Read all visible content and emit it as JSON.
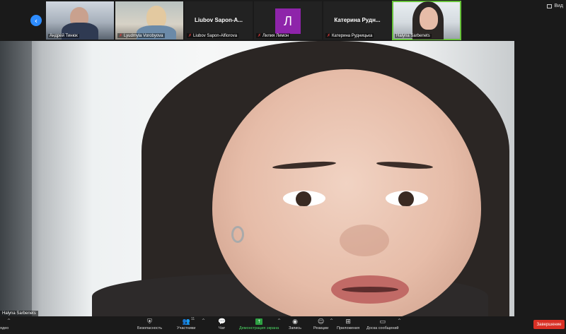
{
  "strip": {
    "view_label": "Вид",
    "tiles": [
      {
        "name": "Андрей Тинюк",
        "muted": false
      },
      {
        "name": "Lyudmyla Vorobyova",
        "muted": true
      },
      {
        "name": "Liubov Sapon-Alfiorova",
        "display_name": "Liubov  Sapon-A...",
        "muted": true
      },
      {
        "name": "Лилия Лимон",
        "avatar_letter": "Л",
        "avatar_color": "#8e24aa",
        "muted": true
      },
      {
        "name": "Катерина Рудницька",
        "display_name": "Катерина  Рудн...",
        "muted": true
      },
      {
        "name": "Halyna Sarbenets",
        "muted": false,
        "active": true
      }
    ]
  },
  "main": {
    "speaker_label": "Halyna Sarbenets"
  },
  "toolbar": {
    "items": [
      {
        "label": "ядео",
        "icon": "video-icon"
      },
      {
        "label": "Безопасность",
        "icon": "shield-icon"
      },
      {
        "label": "Участники",
        "icon": "participants-icon",
        "count": "11"
      },
      {
        "label": "Чат",
        "icon": "chat-icon"
      },
      {
        "label": "Демонстрация экрана",
        "icon": "share-screen-icon"
      },
      {
        "label": "Запись",
        "icon": "record-icon"
      },
      {
        "label": "Реакции",
        "icon": "reactions-icon"
      },
      {
        "label": "Приложения",
        "icon": "apps-icon"
      },
      {
        "label": "Доска сообщений",
        "icon": "whiteboard-icon"
      }
    ],
    "end_label": "Завершение"
  },
  "colors": {
    "accent": "#2d8cff",
    "active_border": "#67c23a",
    "share_green": "#2ea043",
    "end_red": "#d93025"
  }
}
